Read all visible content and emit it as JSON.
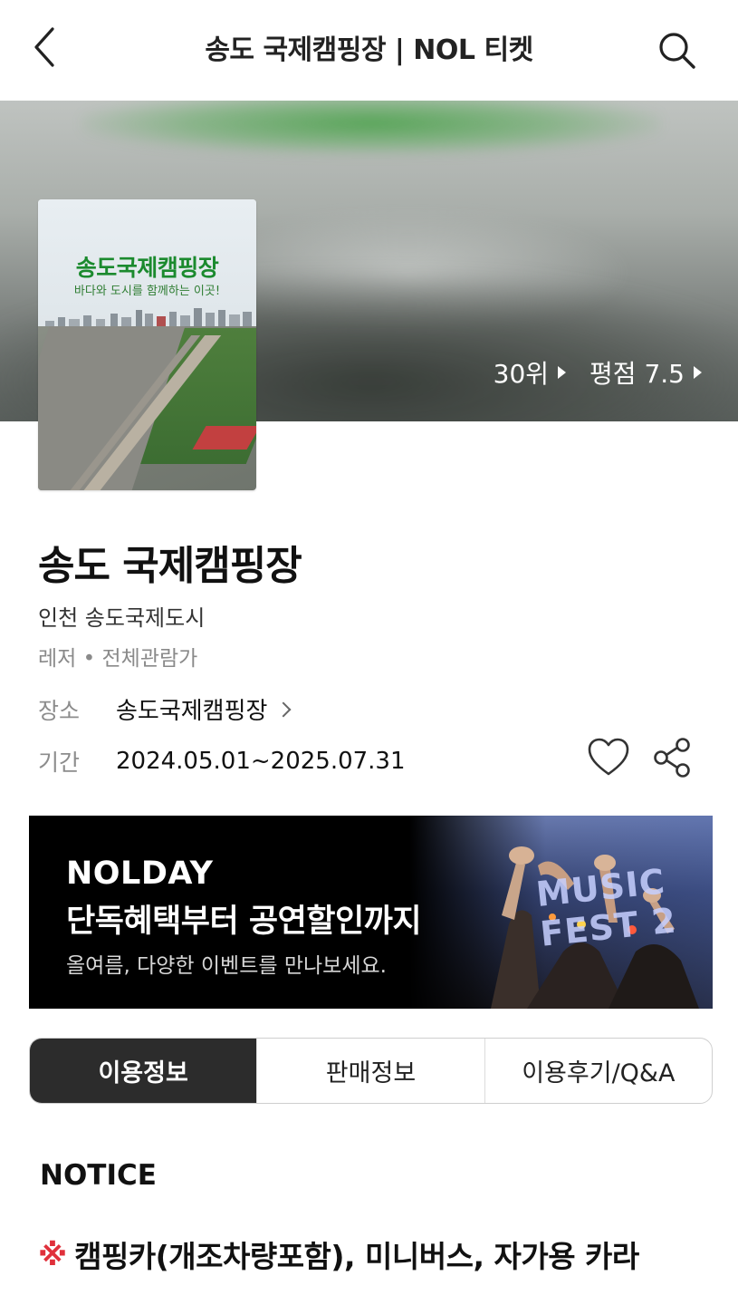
{
  "header": {
    "title": "송도 국제캠핑장 | NOL 티켓",
    "back_icon": "chevron-left-icon",
    "search_icon": "search-icon"
  },
  "hero": {
    "rank": "30위",
    "rating": "평점 7.5"
  },
  "poster": {
    "title": "송도국제캠핑장",
    "subtitle": "바다와 도시를 함께하는 이곳!"
  },
  "event": {
    "title": "송도 국제캠핑장",
    "location": "인천 송도국제도시",
    "category": "레저 • 전체관람가",
    "venue_label": "장소",
    "venue": "송도국제캠핑장",
    "period_label": "기간",
    "period": "2024.05.01~2025.07.31"
  },
  "banner": {
    "title_line1": "NOLDAY",
    "title_line2": "단독혜택부터 공연할인까지",
    "subtitle": "올여름, 다양한 이벤트를 만나보세요.",
    "photo_text": "MUSIC FEST 2"
  },
  "tabs": [
    {
      "label": "이용정보",
      "active": true
    },
    {
      "label": "판매정보",
      "active": false
    },
    {
      "label": "이용후기/Q&A",
      "active": false
    }
  ],
  "notice": {
    "heading": "NOTICE",
    "mark": "※",
    "text": "캠핑카(개조차량포함), 미니버스, 자가용 카라"
  },
  "colors": {
    "accent_red": "#e0303b",
    "active_tab": "#2c2c2c",
    "poster_green": "#1b8a2e"
  }
}
